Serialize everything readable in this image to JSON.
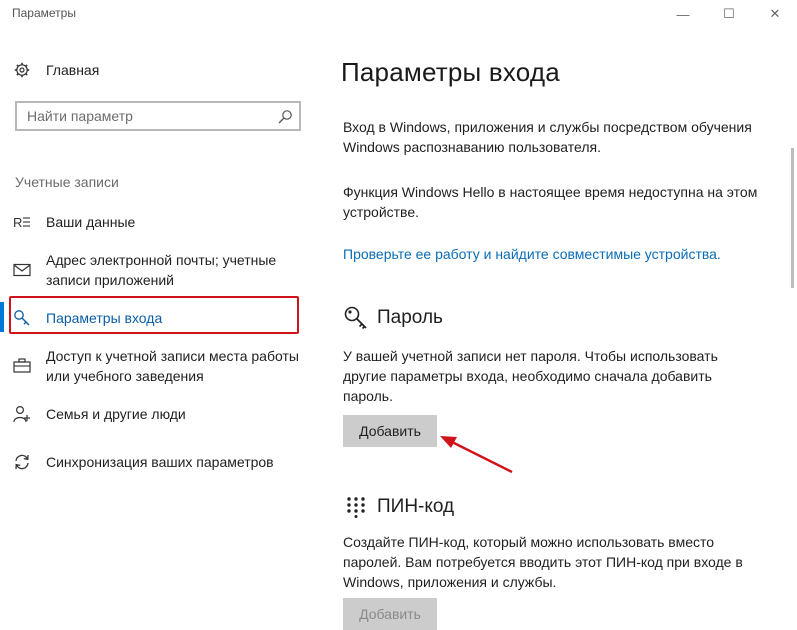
{
  "window": {
    "title": "Параметры",
    "minimize_glyph": "—",
    "maximize_glyph": "☐",
    "close_glyph": "✕"
  },
  "sidebar": {
    "home_label": "Главная",
    "search_placeholder": "Найти параметр",
    "section_title": "Учетные записи",
    "items": [
      {
        "label": "Ваши данные",
        "icon": "person-card-icon"
      },
      {
        "label": "Адрес электронной почты; учетные записи приложений",
        "icon": "mail-icon"
      },
      {
        "label": "Параметры входа",
        "icon": "key-icon",
        "active": true
      },
      {
        "label": "Доступ к учетной записи места работы или учебного заведения",
        "icon": "briefcase-icon"
      },
      {
        "label": "Семья и другие люди",
        "icon": "add-person-icon"
      },
      {
        "label": "Синхронизация ваших параметров",
        "icon": "sync-icon"
      }
    ]
  },
  "main": {
    "title": "Параметры входа",
    "intro": "Вход в Windows, приложения и службы посредством обучения Windows распознаванию пользователя.",
    "hello_status": "Функция Windows Hello в настоящее время недоступна на этом устройстве.",
    "hello_link": "Проверьте ее работу и найдите совместимые устройства.",
    "password": {
      "heading": "Пароль",
      "description": "У вашей учетной записи нет пароля. Чтобы использовать другие параметры входа, необходимо сначала добавить пароль.",
      "button": "Добавить"
    },
    "pin": {
      "heading": "ПИН-код",
      "description": "Создайте ПИН-код, который можно использовать вместо паролей. Вам потребуется вводить этот ПИН-код при входе в Windows, приложения и службы.",
      "button": "Добавить"
    }
  },
  "colors": {
    "accent": "#0078d7",
    "link": "#0b6db6",
    "annotation_red": "#d0141c",
    "button_bg": "#cccccc"
  }
}
